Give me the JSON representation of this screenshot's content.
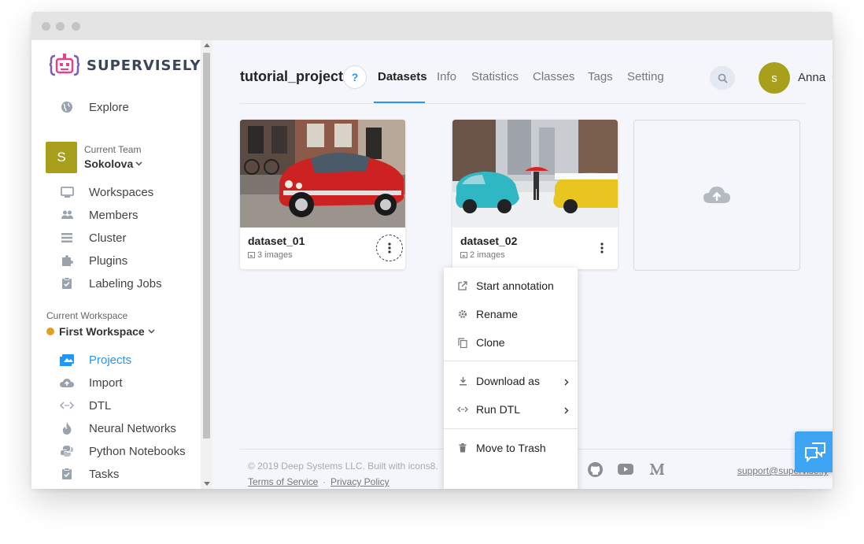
{
  "brand": {
    "name": "SUPERVISELY"
  },
  "sidebar": {
    "explore": "Explore",
    "team_label": "Current Team",
    "team_name": "Sokolova",
    "team_initial": "S",
    "team_items": [
      {
        "label": "Workspaces",
        "icon": "monitor-icon"
      },
      {
        "label": "Members",
        "icon": "people-icon"
      },
      {
        "label": "Cluster",
        "icon": "list-icon"
      },
      {
        "label": "Plugins",
        "icon": "puzzle-icon"
      },
      {
        "label": "Labeling Jobs",
        "icon": "clipboard-check-icon"
      }
    ],
    "workspace_label": "Current Workspace",
    "workspace_name": "First Workspace",
    "workspace_items": [
      {
        "label": "Projects",
        "icon": "image-icon",
        "active": true
      },
      {
        "label": "Import",
        "icon": "cloud-upload-icon"
      },
      {
        "label": "DTL",
        "icon": "code-icon"
      },
      {
        "label": "Neural Networks",
        "icon": "flame-icon"
      },
      {
        "label": "Python Notebooks",
        "icon": "python-icon"
      },
      {
        "label": "Tasks",
        "icon": "clipboard-check-icon"
      }
    ]
  },
  "header": {
    "project_title": "tutorial_project",
    "help": "?",
    "tabs": [
      "Datasets",
      "Info",
      "Statistics",
      "Classes",
      "Tags",
      "Setting"
    ],
    "active_tab": "Datasets",
    "user_initial": "s",
    "user_name": "Anna"
  },
  "datasets": [
    {
      "name": "dataset_01",
      "images": "3 images"
    },
    {
      "name": "dataset_02",
      "images": "2 images"
    }
  ],
  "context_menu": {
    "items": [
      {
        "label": "Start annotation",
        "icon": "external-link-icon"
      },
      {
        "label": "Rename",
        "icon": "gear-icon"
      },
      {
        "label": "Clone",
        "icon": "copy-icon"
      },
      {
        "label": "Download as",
        "icon": "download-icon",
        "submenu": true
      },
      {
        "label": "Run DTL",
        "icon": "code-icon",
        "submenu": true
      },
      {
        "label": "Move to Trash",
        "icon": "trash-icon"
      }
    ]
  },
  "footer": {
    "copyright": "© 2019 Deep Systems LLC. Built with icons8.",
    "terms": "Terms of Service",
    "separator": "·",
    "privacy": "Privacy Policy",
    "support": "support@supervise.ly"
  },
  "colors": {
    "accent": "#2196f3",
    "avatar": "#a8a01c",
    "workspace_dot": "#e0a020",
    "chat": "#3ea4f4"
  }
}
